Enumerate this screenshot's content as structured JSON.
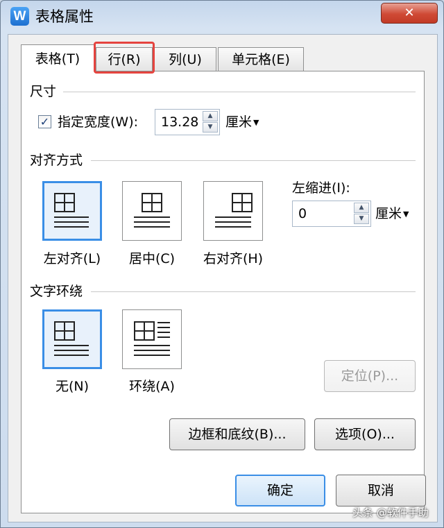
{
  "window": {
    "title": "表格属性",
    "app_icon_letter": "W",
    "close_glyph": "✕"
  },
  "tabs": [
    {
      "label": "表格(T)",
      "active": true
    },
    {
      "label": "行(R)",
      "active": false,
      "highlighted": true
    },
    {
      "label": "列(U)",
      "active": false
    },
    {
      "label": "单元格(E)",
      "active": false
    }
  ],
  "size": {
    "group_title": "尺寸",
    "checkbox_checked": true,
    "check_glyph": "✓",
    "width_label": "指定宽度(W):",
    "width_value": "13.28",
    "unit": "厘米"
  },
  "alignment": {
    "group_title": "对齐方式",
    "options": [
      {
        "label": "左对齐(L)",
        "selected": true
      },
      {
        "label": "居中(C)",
        "selected": false
      },
      {
        "label": "右对齐(H)",
        "selected": false
      }
    ],
    "indent_label": "左缩进(I):",
    "indent_value": "0",
    "unit": "厘米"
  },
  "wrapping": {
    "group_title": "文字环绕",
    "options": [
      {
        "label": "无(N)",
        "selected": true
      },
      {
        "label": "环绕(A)",
        "selected": false
      }
    ],
    "position_button": "定位(P)..."
  },
  "buttons": {
    "borders": "边框和底纹(B)...",
    "options": "选项(O)...",
    "ok": "确定",
    "cancel": "取消"
  },
  "watermark": "头条 @软件手助",
  "colors": {
    "accent": "#3a8ee6",
    "highlight": "#e5443f",
    "close": "#cf4a35"
  }
}
